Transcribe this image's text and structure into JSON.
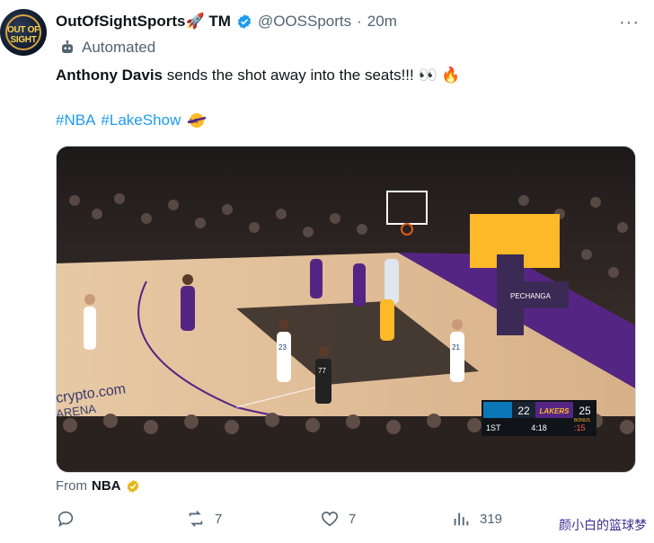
{
  "author": {
    "display_name": "OutOfSightSports",
    "name_emoji": "🚀",
    "name_suffix": "TM",
    "handle": "@OOSSports",
    "separator": "·",
    "time": "20m",
    "avatar_text": "OUT OF SIGHT",
    "label": "Automated"
  },
  "tweet": {
    "bold_name": "Anthony Davis",
    "text_rest": " sends the shot away into the seats!!! 👀 🔥",
    "hashtags": [
      "#NBA",
      "#LakeShow"
    ]
  },
  "media": {
    "scoreboard": {
      "away_score": "22",
      "home_team": "LAKERS",
      "home_score": "25",
      "quarter": "1ST",
      "clock": "4:18",
      "shot_clock": ":15",
      "bonus": "BONUS"
    },
    "court_text": [
      "crypto.com",
      "ARENA"
    ],
    "ad_text": "PECHANGA",
    "jersey_numbers": [
      "23",
      "21",
      "77"
    ]
  },
  "source": {
    "prefix": "From",
    "name": "NBA"
  },
  "actions": {
    "replies": "",
    "reposts": "7",
    "likes": "7",
    "views": "319"
  },
  "watermark": {
    "text": "颜小白的篮球梦",
    "color": "#3a2f8f"
  },
  "colors": {
    "link": "#1d9bf0",
    "verified": "#1d9bf0",
    "secondary_text": "#536471",
    "lakers_purple": "#552583",
    "lakers_gold": "#fdb927"
  }
}
